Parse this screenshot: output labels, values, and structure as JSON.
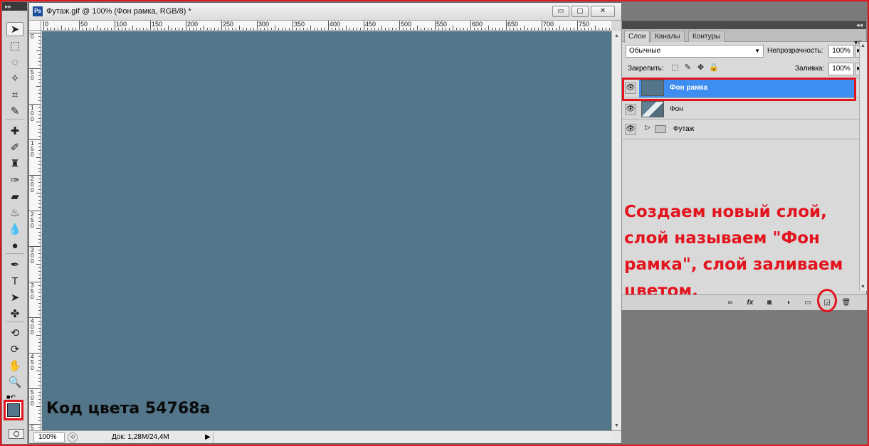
{
  "document": {
    "title": "Футаж.gif @ 100% (Фон рамка, RGB/8) *",
    "ps_logo": "Ps",
    "minimize": "▭",
    "restore": "▢",
    "close": "✕",
    "zoom": "100%",
    "doc_info": "Док: 1,28M/24,4M",
    "canvas_color": "#54768a",
    "color_note": "Код цвета 54768a",
    "ruler_h_labels": [
      "0",
      "50",
      "100",
      "150",
      "200",
      "250",
      "300",
      "350",
      "400",
      "450",
      "500",
      "550",
      "600",
      "650",
      "700",
      "750"
    ],
    "ruler_v_labels": [
      "0",
      "5 0",
      "1 0 0",
      "1 5 0",
      "2 0 0",
      "2 5 0",
      "3 0 0",
      "3 5 0",
      "4 0 0",
      "4 5 0",
      "5 0 0",
      "5"
    ]
  },
  "toolbox": {
    "header": "▸▸",
    "tools": [
      {
        "name": "move-tool",
        "glyph": "➤",
        "active": true
      },
      {
        "name": "marquee-tool",
        "glyph": "⬚"
      },
      {
        "name": "lasso-tool",
        "glyph": "◌"
      },
      {
        "name": "magic-wand-tool",
        "glyph": "✧"
      },
      {
        "name": "crop-tool",
        "glyph": "⌗"
      },
      {
        "name": "eyedropper-tool",
        "glyph": "✎"
      },
      {
        "name": "healing-tool",
        "glyph": "✚"
      },
      {
        "name": "brush-tool",
        "glyph": "✐"
      },
      {
        "name": "stamp-tool",
        "glyph": "♜"
      },
      {
        "name": "history-brush-tool",
        "glyph": "✑"
      },
      {
        "name": "eraser-tool",
        "glyph": "▰"
      },
      {
        "name": "bucket-tool",
        "glyph": "♨"
      },
      {
        "name": "blur-tool",
        "glyph": "💧"
      },
      {
        "name": "dodge-tool",
        "glyph": "●"
      },
      {
        "name": "pen-tool",
        "glyph": "✒"
      },
      {
        "name": "type-tool",
        "glyph": "T"
      },
      {
        "name": "path-select-tool",
        "glyph": "➤"
      },
      {
        "name": "shape-tool",
        "glyph": "✤"
      },
      {
        "name": "3d-rotate-tool",
        "glyph": "⟲"
      },
      {
        "name": "3d-orbit-tool",
        "glyph": "⟳"
      },
      {
        "name": "hand-tool",
        "glyph": "✋"
      },
      {
        "name": "zoom-tool",
        "glyph": "🔍"
      }
    ],
    "fg_color": "#54768a"
  },
  "layers_panel": {
    "tabs": [
      "Слои",
      "Каналы",
      "Контуры"
    ],
    "panel_menu": "▾≡",
    "collapse": "◂◂",
    "blend_mode": "Обычные",
    "opacity_label": "Непрозрачность:",
    "opacity": "100%",
    "lock_label": "Закрепить:",
    "fill_label": "Заливка:",
    "fill": "100%",
    "layers": [
      {
        "name": "Фон рамка",
        "selected": true,
        "visible": true
      },
      {
        "name": "Фон",
        "selected": false,
        "visible": true
      },
      {
        "name": "Футаж",
        "selected": false,
        "visible": true,
        "group": true
      }
    ],
    "instruction": "Создаем новый слой, слой называем \"Фон рамка\", слой заливаем цветом.",
    "bottom_icons": [
      "link-icon",
      "fx-icon",
      "mask-icon",
      "adjustment-icon",
      "group-icon",
      "new-layer-icon",
      "trash-icon"
    ]
  },
  "colors": {
    "highlight_red": "#e2141e",
    "selection_blue": "#3d8ef0"
  }
}
